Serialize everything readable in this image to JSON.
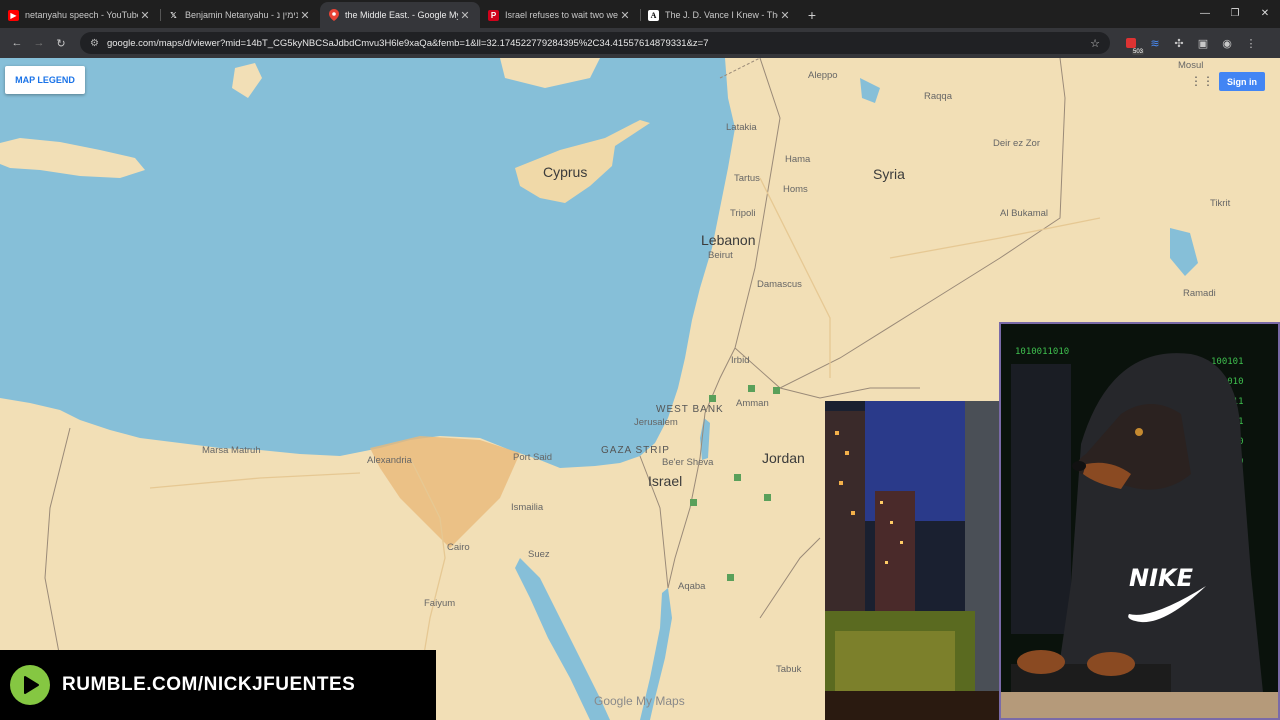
{
  "browser": {
    "tabs": [
      {
        "title": "netanyahu speech - YouTube",
        "favicon": "youtube-icon",
        "color": "#ff0000",
        "active": false
      },
      {
        "title": "Benjamin Netanyahu - בנימין נ",
        "favicon": "x-icon",
        "color": "#000000",
        "active": false
      },
      {
        "title": "the Middle East. - Google My M",
        "favicon": "maps-pin-icon",
        "color": "#ea4335",
        "active": true
      },
      {
        "title": "Israel refuses to wait two week",
        "favicon": "politico-icon",
        "color": "#d0021b",
        "active": false
      },
      {
        "title": "The J. D. Vance I Knew - The Atl",
        "favicon": "atlantic-icon",
        "color": "#ffffff",
        "active": false
      }
    ],
    "url": "google.com/maps/d/viewer?mid=14bT_CG5kyNBCSaJdbdCmvu3H6le9xaQa&femb=1&ll=32.174522779284395%2C34.41557614879331&z=7",
    "extension_count": "503"
  },
  "map": {
    "legend_button": "MAP LEGEND",
    "sign_in": "Sign in",
    "watermark": "Google My Maps",
    "countries": [
      {
        "name": "Cyprus"
      },
      {
        "name": "Syria"
      },
      {
        "name": "Lebanon"
      },
      {
        "name": "Israel"
      },
      {
        "name": "Jordan"
      }
    ],
    "regions": [
      {
        "name": "WEST BANK"
      },
      {
        "name": "GAZA STRIP"
      }
    ],
    "cities": [
      {
        "name": "Aleppo"
      },
      {
        "name": "Hama"
      },
      {
        "name": "Homs"
      },
      {
        "name": "Latakia"
      },
      {
        "name": "Tartus"
      },
      {
        "name": "Tripoli"
      },
      {
        "name": "Beirut"
      },
      {
        "name": "Damascus"
      },
      {
        "name": "Amman"
      },
      {
        "name": "Jerusalem"
      },
      {
        "name": "Alexandria"
      },
      {
        "name": "Port Said"
      },
      {
        "name": "Cairo"
      },
      {
        "name": "Suez"
      },
      {
        "name": "Ismailia"
      },
      {
        "name": "Faiyum"
      },
      {
        "name": "Tabuk"
      },
      {
        "name": "Raqqa"
      },
      {
        "name": "Deir ez Zor"
      },
      {
        "name": "Mosul"
      },
      {
        "name": "Tikrit"
      },
      {
        "name": "Ramadi"
      },
      {
        "name": "Al Bukamal"
      },
      {
        "name": "Irbid"
      },
      {
        "name": "Be'er Sheva"
      },
      {
        "name": "Aqaba"
      },
      {
        "name": "Marsa Matruh"
      }
    ]
  },
  "overlay": {
    "rumble_text": "RUMBLE.COM/NICKJFUENTES",
    "hoodie_brand": "NIKE"
  }
}
